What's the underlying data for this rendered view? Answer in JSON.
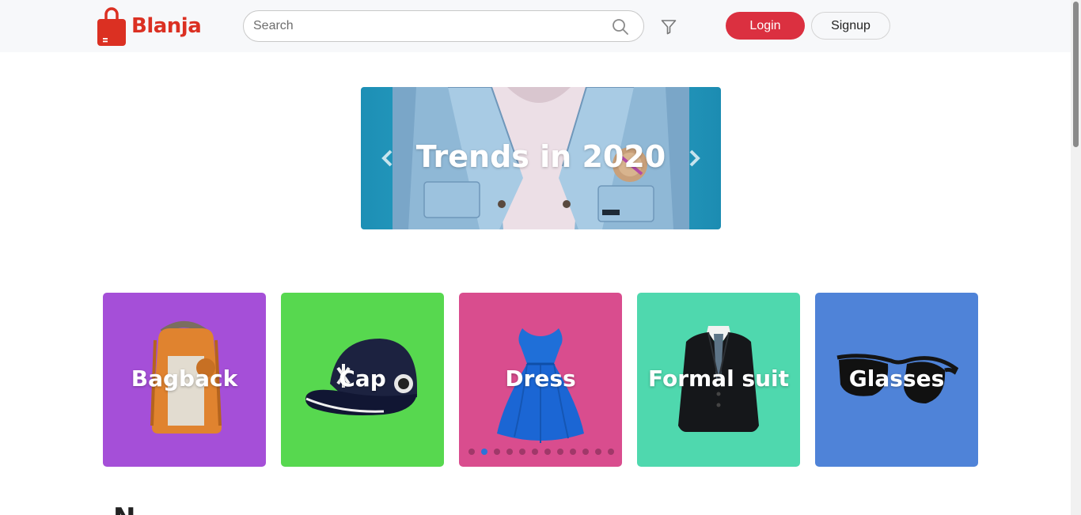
{
  "brand": {
    "name": "Blanja",
    "color": "#db3022",
    "icon": "shopping-bag-icon"
  },
  "search": {
    "placeholder": "Search",
    "value": "",
    "icon": "search-icon"
  },
  "filter": {
    "icon": "filter-icon"
  },
  "auth": {
    "login_label": "Login",
    "signup_label": "Signup",
    "login_color": "#db3040"
  },
  "hero": {
    "title": "Trends in 2020",
    "prev_icon": "chevron-left-icon",
    "next_icon": "chevron-right-icon"
  },
  "categories": [
    {
      "label": "Bagback",
      "color": "#a54fd8",
      "icon": "backpack-icon"
    },
    {
      "label": "Cap",
      "color": "#57d84f",
      "icon": "cap-icon"
    },
    {
      "label": "Dress",
      "color": "#d94d8e",
      "icon": "dress-icon"
    },
    {
      "label": "Formal suit",
      "color": "#4fd8ae",
      "icon": "suit-icon"
    },
    {
      "label": "Glasses",
      "color": "#4f83d8",
      "icon": "sunglasses-icon"
    }
  ],
  "carousel_dots": {
    "count": 12,
    "active_index": 1
  },
  "next_section": {
    "visible_text": "N"
  }
}
